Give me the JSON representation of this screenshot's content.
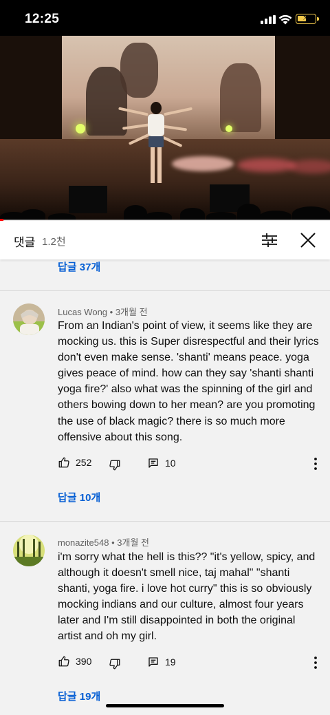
{
  "status_bar": {
    "time": "12:25",
    "battery_level": 0.5
  },
  "video": {
    "progress": 0.01
  },
  "comments_panel": {
    "title": "댓글",
    "count": "1.2천",
    "top_reply_link": "답글 37개",
    "comments": [
      {
        "author": "Lucas Wong",
        "time": "3개월 전",
        "text": "From an Indian's point of view, it seems like they are mocking us. this is Super disrespectful and their lyrics don't even make sense.  'shanti' means peace. yoga gives peace of mind. how can they say 'shanti shanti yoga fire?' also what was the spinning of the girl and others bowing down to her mean? are you promoting the use of black magic? there is so much more offensive about this song.",
        "likes": "252",
        "replies_count": "10",
        "reply_link": "답글 10개"
      },
      {
        "author": "monazite548",
        "time": "3개월 전",
        "text": "i'm sorry what the hell is this?? \"it's yellow, spicy, and although it doesn't smell nice, taj mahal\" \"shanti shanti, yoga fire. i love hot curry\" this is so obviously mocking indians and our culture, almost four years later and I'm still disappointed in both the original artist and oh my girl.",
        "likes": "390",
        "replies_count": "19",
        "reply_link": "답글 19개"
      }
    ]
  },
  "icons": {
    "sort": "sliders-icon",
    "close": "close-icon",
    "like": "thumbs-up-icon",
    "dislike": "thumbs-down-icon",
    "reply": "comment-icon",
    "more": "more-vert-icon"
  },
  "colors": {
    "link": "#065fd4",
    "progress": "#ff0000",
    "background": "#f2f2f2"
  }
}
